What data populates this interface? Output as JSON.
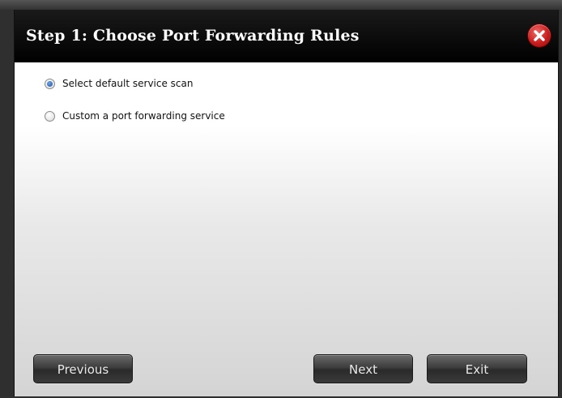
{
  "dialog": {
    "title": "Step 1: Choose Port Forwarding Rules"
  },
  "icons": {
    "close": "close-x-icon",
    "close_color": "#c91d1d"
  },
  "options": [
    {
      "label": "Select default service scan",
      "selected": true
    },
    {
      "label": "Custom a port forwarding service",
      "selected": false
    }
  ],
  "buttons": {
    "previous": "Previous",
    "next": "Next",
    "exit": "Exit"
  }
}
